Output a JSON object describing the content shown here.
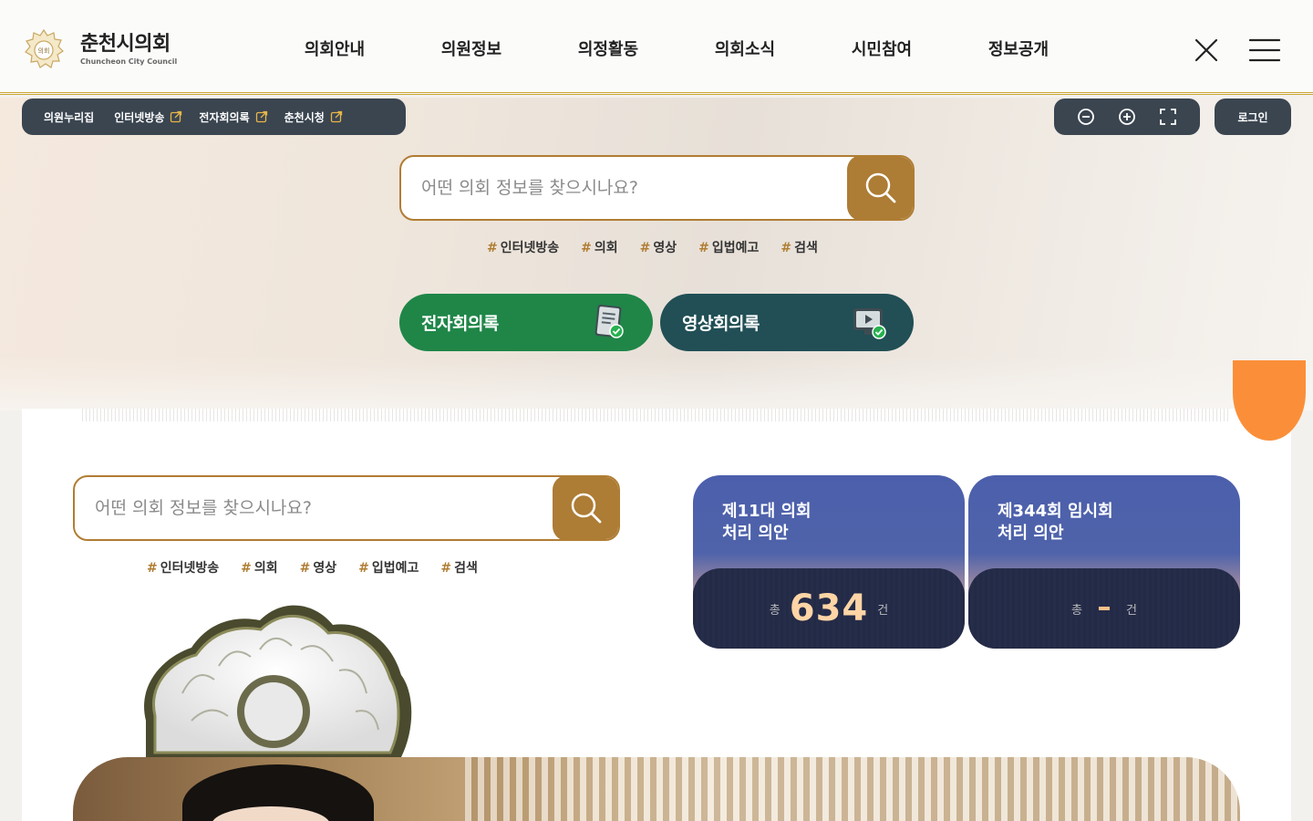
{
  "header": {
    "logo_title": "춘천시의회",
    "logo_sub": "Chuncheon City Council",
    "emblem_text": "의회",
    "nav": [
      "의회안내",
      "의원정보",
      "의정활동",
      "의회소식",
      "시민참여",
      "정보공개"
    ]
  },
  "quick_links": [
    {
      "label": "의원누리집",
      "external": false
    },
    {
      "label": "인터넷방송",
      "external": true
    },
    {
      "label": "전자회의록",
      "external": true
    },
    {
      "label": "춘천시청",
      "external": true
    }
  ],
  "tools": {
    "login_label": "로그인",
    "zoom_out_icon": "minus-circle-icon",
    "zoom_in_icon": "plus-circle-icon",
    "fullscreen_icon": "fullscreen-icon"
  },
  "hero_search": {
    "placeholder": "어떤 의회 정보를 찾으시나요?",
    "tags": [
      "인터넷방송",
      "의회",
      "영상",
      "입법예고",
      "검색"
    ]
  },
  "buttons": {
    "minutes_label": "전자회의록",
    "video_label": "영상회의록"
  },
  "main_search": {
    "placeholder": "어떤 의회 정보를 찾으시나요?",
    "tags": [
      "인터넷방송",
      "의회",
      "영상",
      "입법예고",
      "검색"
    ]
  },
  "stats": [
    {
      "title": "제11대 의회\n처리 의안",
      "prefix": "총",
      "value": "634",
      "suffix": "건"
    },
    {
      "title": "제344회 임시회\n처리 의안",
      "prefix": "총",
      "value": "-",
      "suffix": "건"
    }
  ],
  "colors": {
    "accent": "#ad7c35",
    "dark": "#3a4550",
    "green": "#1f8648",
    "teal": "#214f55",
    "stat_blue": "#4c5fac",
    "orange": "#fb8f39"
  }
}
